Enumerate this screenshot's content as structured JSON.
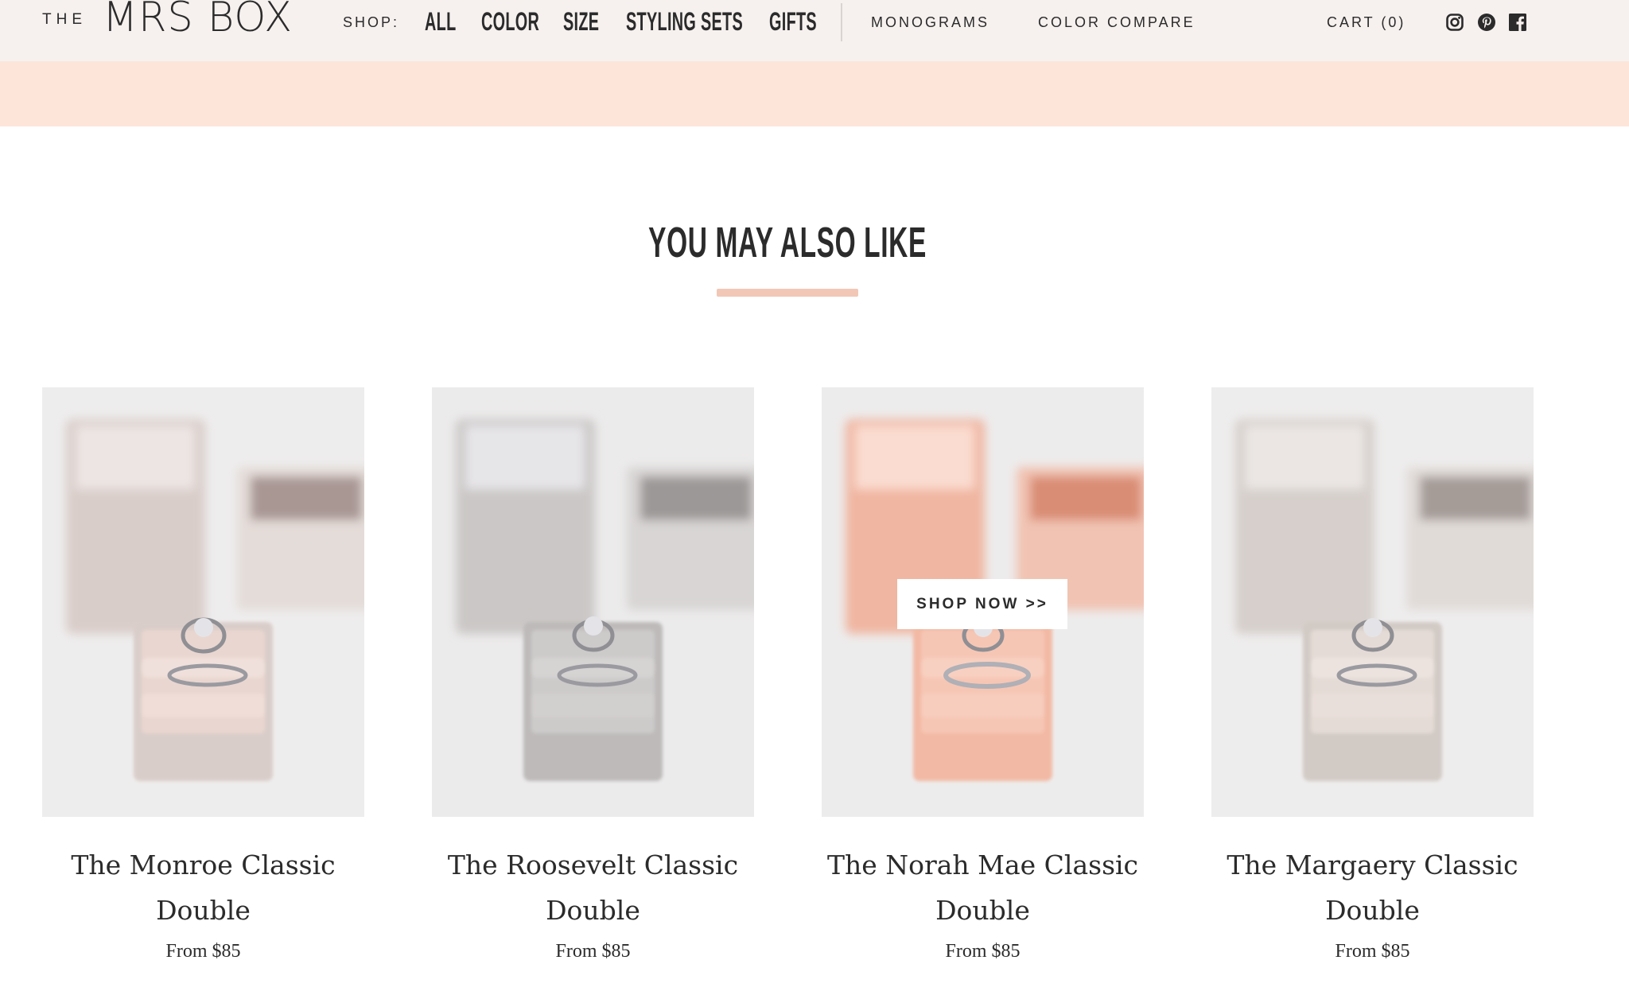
{
  "header": {
    "logo_prefix": "THE",
    "logo_main": "MRS BOX",
    "shop_label": "SHOP:",
    "shop_links": [
      "ALL",
      "COLOR",
      "SIZE",
      "STYLING SETS",
      "GIFTS"
    ],
    "nav_links": [
      "MONOGRAMS",
      "COLOR COMPARE",
      "CART (0)"
    ],
    "social_icons": [
      "instagram-icon",
      "pinterest-icon",
      "facebook-icon"
    ]
  },
  "section": {
    "title": "YOU MAY ALSO LIKE"
  },
  "products": [
    {
      "title_line1": "The Monroe Classic",
      "title_line2": "Double",
      "price": "From $85",
      "box_color": "#d9cdc9",
      "base_color": "#cfc6c2"
    },
    {
      "title_line1": "The Roosevelt Classic",
      "title_line2": "Double",
      "price": "From $85",
      "box_color": "#cbc7c6",
      "base_color": "#bdbab9"
    },
    {
      "title_line1": "The Norah Mae Classic",
      "title_line2": "Double",
      "price": "From $85",
      "box_color": "#f0b6a1",
      "base_color": "#f2b9a4",
      "hover_label": "SHOP NOW >>"
    },
    {
      "title_line1": "The Margaery Classic",
      "title_line2": "Double",
      "price": "From $85",
      "box_color": "#d6cfcb",
      "base_color": "#d2cac5"
    }
  ],
  "colors": {
    "header_bg": "#f6f1ef",
    "banner_bg": "#fde5da",
    "accent_underline": "#f2c7b6",
    "text": "#2b2b2b"
  }
}
